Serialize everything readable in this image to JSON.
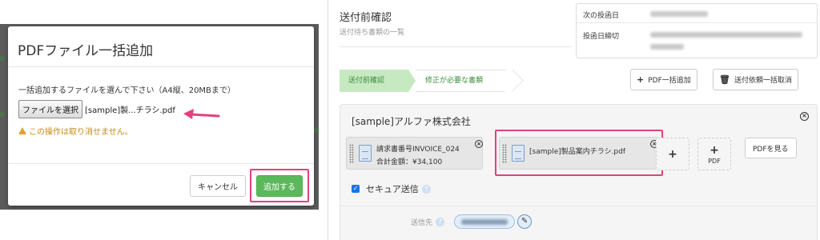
{
  "modal": {
    "title": "PDFファイル一括追加",
    "instruction": "一括追加するファイルを選んで下さい（A4縦、20MBまで）",
    "file_button_label": "ファイルを選択",
    "file_name": "[sample]製...チラシ.pdf",
    "warning": "この操作は取り消せません。",
    "cancel_label": "キャンセル",
    "add_label": "追加する"
  },
  "main": {
    "title": "送付前確認",
    "subtitle": "送付待ち書類の一覧",
    "info": {
      "next_post_label": "次の投函日",
      "deadline_label": "投函日締切"
    },
    "steps": [
      "送付前確認",
      "修正が必要な書類"
    ],
    "toolbar": {
      "add_pdf_label": "PDF一括追加",
      "cancel_all_label": "送付依頼一括取消"
    },
    "company": {
      "name": "[sample]アルファ株式会社",
      "documents": [
        {
          "line1": "請求書番号INVOICE_024",
          "line2": "合計金額：¥34,100"
        },
        {
          "line1": "[sample]製品案内チラシ.pdf"
        }
      ],
      "pdf_tile_label": "PDF",
      "view_pdf_label": "PDFを見る",
      "secure_label": "セキュア送信",
      "destination_label": "送信先"
    }
  },
  "colors": {
    "accent_green": "#5cb85c",
    "highlight_pink": "#e4407e",
    "warning_orange": "#c78a16"
  }
}
